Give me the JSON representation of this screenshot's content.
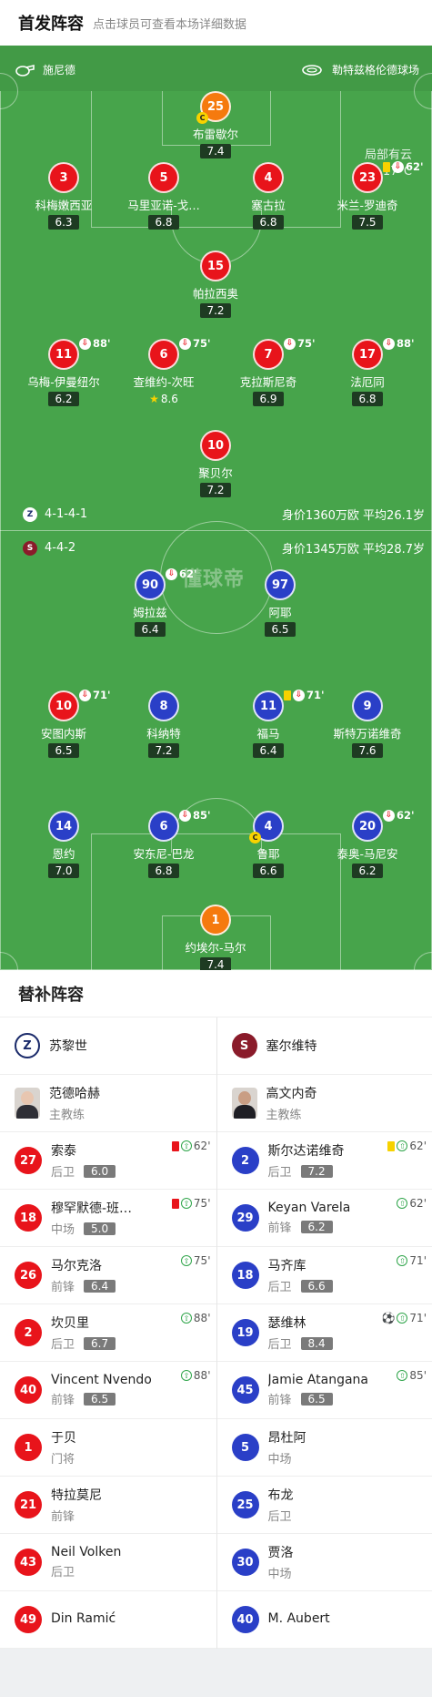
{
  "header": {
    "title": "首发阵容",
    "subtitle": "点击球员可查看本场详细数据"
  },
  "pitch_info": {
    "referee": "施尼德",
    "stadium": "勒特兹格伦德球场",
    "weather": "局部有云",
    "temperature": "17°C",
    "watermark": "懂球帝"
  },
  "home_formation": {
    "formation": "4-1-4-1",
    "value": "身价1360万欧 平均26.1岁"
  },
  "away_formation": {
    "formation": "4-4-2",
    "value": "身价1345万欧 平均28.7岁"
  },
  "home_players": [
    {
      "num": "25",
      "name": "布雷歇尔",
      "rating": "7.4",
      "captain": "C"
    },
    {
      "num": "3",
      "name": "科梅嫩西亚",
      "rating": "6.3"
    },
    {
      "num": "5",
      "name": "马里亚诺-戈…",
      "rating": "6.8"
    },
    {
      "num": "4",
      "name": "塞古拉",
      "rating": "6.8"
    },
    {
      "num": "23",
      "name": "米兰-罗迪奇",
      "rating": "7.5",
      "sub_min": "62'"
    },
    {
      "num": "15",
      "name": "帕拉西奥",
      "rating": "7.2"
    },
    {
      "num": "11",
      "name": "乌梅-伊曼纽尔",
      "rating": "6.2",
      "sub_min": "88'"
    },
    {
      "num": "6",
      "name": "查维约-次旺",
      "rating": "8.6",
      "sub_min": "75'"
    },
    {
      "num": "7",
      "name": "克拉斯尼奇",
      "rating": "6.9",
      "sub_min": "75'"
    },
    {
      "num": "17",
      "name": "法厄同",
      "rating": "6.8",
      "sub_min": "88'"
    },
    {
      "num": "10",
      "name": "聚贝尔",
      "rating": "7.2"
    }
  ],
  "away_players": [
    {
      "num": "90",
      "name": "姆拉兹",
      "rating": "6.4",
      "sub_min": "62'"
    },
    {
      "num": "97",
      "name": "阿耶",
      "rating": "6.5"
    },
    {
      "num": "10",
      "name": "安图内斯",
      "rating": "6.5",
      "sub_min": "71'"
    },
    {
      "num": "8",
      "name": "科纳特",
      "rating": "7.2"
    },
    {
      "num": "11",
      "name": "福马",
      "rating": "6.4",
      "sub_min": "71'"
    },
    {
      "num": "9",
      "name": "斯特万诺维奇",
      "rating": "7.6"
    },
    {
      "num": "14",
      "name": "恩约",
      "rating": "7.0"
    },
    {
      "num": "6",
      "name": "安东尼-巴龙",
      "rating": "6.8",
      "sub_min": "85'"
    },
    {
      "num": "4",
      "name": "鲁耶",
      "rating": "6.6",
      "captain": "C"
    },
    {
      "num": "20",
      "name": "泰奥-马尼安",
      "rating": "6.2",
      "sub_min": "62'"
    },
    {
      "num": "1",
      "name": "约埃尔-马尔",
      "rating": "7.4"
    }
  ],
  "subs": {
    "title": "替补阵容",
    "home": {
      "team": "苏黎世",
      "coach": {
        "name": "范德哈赫",
        "role": "主教练"
      },
      "players": [
        {
          "num": "27",
          "name": "索泰",
          "pos": "后卫",
          "rating": "6.0",
          "event": "62'"
        },
        {
          "num": "18",
          "name": "穆罕默德-班…",
          "pos": "中场",
          "rating": "5.0",
          "event": "75'"
        },
        {
          "num": "26",
          "name": "马尔克洛",
          "pos": "前锋",
          "rating": "6.4",
          "event": "75'"
        },
        {
          "num": "2",
          "name": "坎贝里",
          "pos": "后卫",
          "rating": "6.7",
          "event": "88'"
        },
        {
          "num": "40",
          "name": "Vincent Nvendo",
          "pos": "前锋",
          "rating": "6.5",
          "event": "88'"
        },
        {
          "num": "1",
          "name": "于贝",
          "pos": "门将"
        },
        {
          "num": "21",
          "name": "特拉莫尼",
          "pos": "前锋"
        },
        {
          "num": "43",
          "name": "Neil Volken",
          "pos": "后卫"
        },
        {
          "num": "49",
          "name": "Din Ramić",
          "pos": ""
        }
      ]
    },
    "away": {
      "team": "塞尔维特",
      "coach": {
        "name": "高文内奇",
        "role": "主教练"
      },
      "players": [
        {
          "num": "2",
          "name": "斯尔达诺维奇",
          "pos": "后卫",
          "rating": "7.2",
          "event": "62'"
        },
        {
          "num": "29",
          "name": "Keyan Varela",
          "pos": "前锋",
          "rating": "6.2",
          "event": "62'"
        },
        {
          "num": "18",
          "name": "马齐库",
          "pos": "后卫",
          "rating": "6.6",
          "event": "71'"
        },
        {
          "num": "19",
          "name": "瑟维林",
          "pos": "后卫",
          "rating": "8.4",
          "event": "71'"
        },
        {
          "num": "45",
          "name": "Jamie Atangana",
          "pos": "前锋",
          "rating": "6.5",
          "event": "85'"
        },
        {
          "num": "5",
          "name": "昂杜阿",
          "pos": "中场"
        },
        {
          "num": "25",
          "name": "布龙",
          "pos": "后卫"
        },
        {
          "num": "30",
          "name": "贾洛",
          "pos": "中场"
        },
        {
          "num": "40",
          "name": "M. Aubert",
          "pos": ""
        }
      ]
    }
  }
}
